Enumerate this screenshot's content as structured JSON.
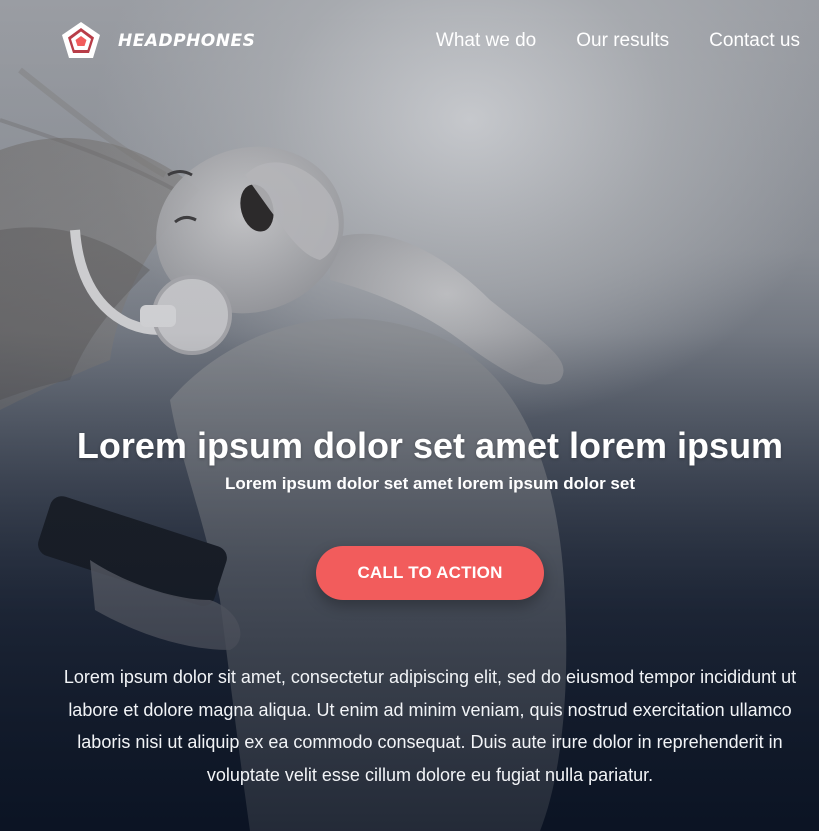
{
  "header": {
    "brand": "HEADPHONES",
    "nav": [
      {
        "label": "What we do"
      },
      {
        "label": "Our results"
      },
      {
        "label": "Contact us"
      }
    ]
  },
  "hero": {
    "headline": "Lorem ipsum dolor set amet lorem ipsum",
    "subheadline": "Lorem ipsum dolor set amet lorem ipsum dolor set",
    "cta_label": "CALL TO ACTION",
    "body": "Lorem ipsum dolor sit amet, consectetur adipiscing elit, sed do eiusmod tempor incididunt ut labore et dolore magna aliqua. Ut enim ad minim veniam, quis nostrud exercitation ullamco laboris nisi ut aliquip ex ea commodo consequat. Duis aute irure dolor in reprehenderit in voluptate velit esse cillum dolore eu fugiat nulla pariatur."
  },
  "icons": {
    "logo": "pentagon-logo-icon"
  },
  "colors": {
    "accent": "#f25c5c",
    "text": "#ffffff",
    "background_dark": "#101a2c"
  }
}
